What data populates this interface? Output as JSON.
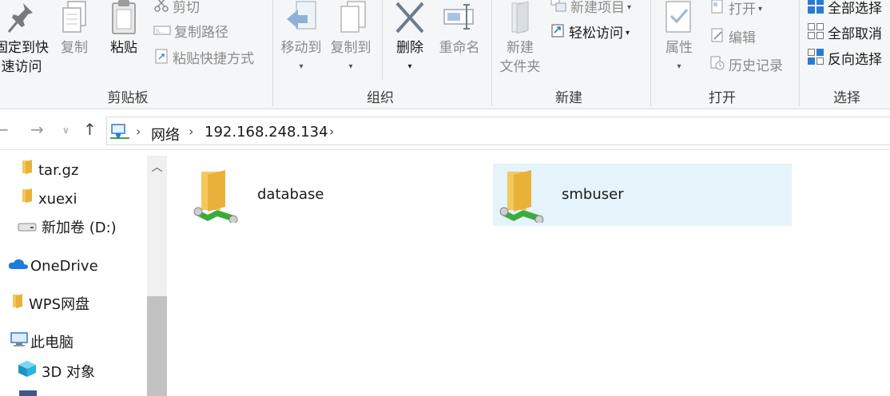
{
  "ribbon": {
    "clipboard": {
      "label": "剪贴板",
      "pin": {
        "line1": "固定到快",
        "line2": "速访问"
      },
      "copy": "复制",
      "paste": "粘贴",
      "cut": "剪切",
      "copy_path": "复制路径",
      "paste_shortcut": "粘贴快捷方式"
    },
    "organize": {
      "label": "组织",
      "move_to": "移动到",
      "copy_to": "复制到",
      "delete": "删除",
      "rename": "重命名"
    },
    "new": {
      "label": "新建",
      "new_folder": {
        "line1": "新建",
        "line2": "文件夹"
      },
      "new_item": "新建项目",
      "easy_access": "轻松访问"
    },
    "open": {
      "label": "打开",
      "properties": "属性",
      "open": "打开",
      "edit": "编辑",
      "history": "历史记录"
    },
    "select": {
      "label": "选择",
      "select_all": "全部选择",
      "select_none": "全部取消",
      "invert": "反向选择"
    }
  },
  "address": {
    "crumbs": [
      "网络",
      "192.168.248.134"
    ]
  },
  "nav": {
    "items": [
      {
        "label": "tar.gz"
      },
      {
        "label": "xuexi"
      },
      {
        "label": "新加卷 (D:)"
      },
      {
        "label": "OneDrive"
      },
      {
        "label": "WPS网盘"
      },
      {
        "label": "此电脑"
      },
      {
        "label": "3D 对象"
      }
    ]
  },
  "content": {
    "shares": [
      {
        "name": "database",
        "selected": false
      },
      {
        "name": "smbuser",
        "selected": true
      }
    ]
  },
  "colors": {
    "selection": "#e5f3fb",
    "folder": "#f4c85a",
    "network_green": "#3cab3c",
    "accent_blue": "#2a7ad5"
  }
}
